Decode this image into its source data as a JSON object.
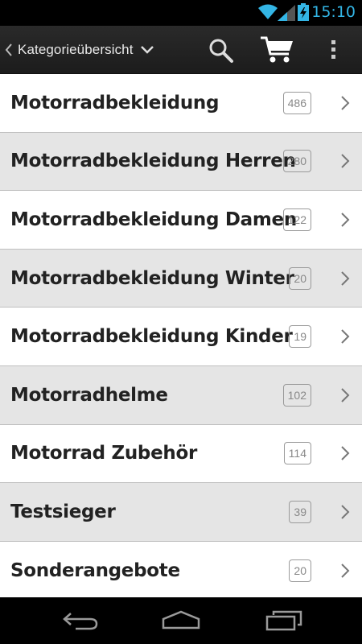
{
  "status_bar": {
    "time": "15:10",
    "accent": "#33b5e5"
  },
  "action_bar": {
    "title": "Kategorieübersicht"
  },
  "categories": [
    {
      "label": "Motorradbekleidung",
      "count": "486"
    },
    {
      "label": "Motorradbekleidung Herren",
      "count": "280"
    },
    {
      "label": "Motorradbekleidung Damen",
      "count": "122"
    },
    {
      "label": "Motorradbekleidung Winter",
      "count": "20"
    },
    {
      "label": "Motorradbekleidung Kinder",
      "count": "19"
    },
    {
      "label": "Motorradhelme",
      "count": "102"
    },
    {
      "label": "Motorrad Zubehör",
      "count": "114"
    },
    {
      "label": "Testsieger",
      "count": "39"
    },
    {
      "label": "Sonderangebote",
      "count": "20"
    }
  ]
}
